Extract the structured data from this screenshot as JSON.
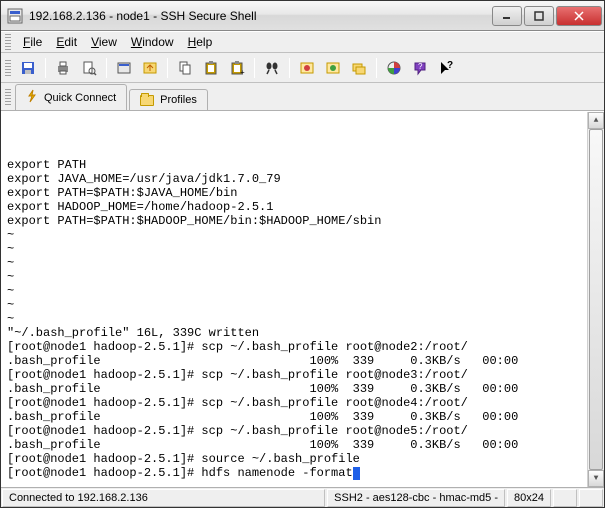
{
  "window": {
    "title": "192.168.2.136 - node1 - SSH Secure Shell"
  },
  "menu": {
    "file": "File",
    "edit": "Edit",
    "view": "View",
    "window": "Window",
    "help": "Help"
  },
  "tabs": {
    "quick_connect": "Quick Connect",
    "profiles": "Profiles"
  },
  "terminal": {
    "lines": [
      "",
      "export PATH",
      "export JAVA_HOME=/usr/java/jdk1.7.0_79",
      "export PATH=$PATH:$JAVA_HOME/bin",
      "export HADOOP_HOME=/home/hadoop-2.5.1",
      "export PATH=$PATH:$HADOOP_HOME/bin:$HADOOP_HOME/sbin",
      "~",
      "~",
      "~",
      "~",
      "~",
      "~",
      "~",
      "\"~/.bash_profile\" 16L, 339C written",
      "[root@node1 hadoop-2.5.1]# scp ~/.bash_profile root@node2:/root/",
      ".bash_profile                             100%  339     0.3KB/s   00:00",
      "[root@node1 hadoop-2.5.1]# scp ~/.bash_profile root@node3:/root/",
      ".bash_profile                             100%  339     0.3KB/s   00:00",
      "[root@node1 hadoop-2.5.1]# scp ~/.bash_profile root@node4:/root/",
      ".bash_profile                             100%  339     0.3KB/s   00:00",
      "[root@node1 hadoop-2.5.1]# scp ~/.bash_profile root@node5:/root/",
      ".bash_profile                             100%  339     0.3KB/s   00:00",
      "[root@node1 hadoop-2.5.1]# source ~/.bash_profile",
      "[root@node1 hadoop-2.5.1]# hdfs namenode -format"
    ]
  },
  "status": {
    "connection": "Connected to 192.168.2.136",
    "cipher": "SSH2 - aes128-cbc - hmac-md5 - ",
    "size": "80x24"
  },
  "icons": {
    "save": "save-icon",
    "print": "print-icon",
    "preview": "preview-icon",
    "new": "new-terminal-icon",
    "transfer": "file-transfer-icon",
    "copy": "copy-icon",
    "paste": "paste-icon",
    "clipboard": "clipboard-icon",
    "find": "find-icon",
    "disconnect": "disconnect-icon",
    "connect": "connect-icon",
    "folders": "folders-icon",
    "colors": "colors-icon",
    "help": "help-icon",
    "whatsthis": "whats-this-icon",
    "lightning": "lightning-icon",
    "folder": "folder-icon"
  }
}
